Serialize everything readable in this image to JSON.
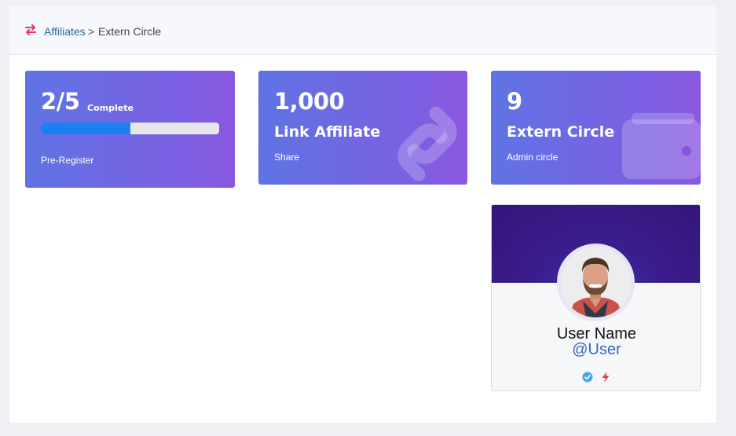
{
  "breadcrumb": {
    "icon": "arrows-swap-icon",
    "link": "Affiliates",
    "separator": ">",
    "current": "Extern Circle"
  },
  "cards": [
    {
      "value": "2/5",
      "value_suffix": "Complete",
      "progress": 0.5,
      "caption": "Pre-Register"
    },
    {
      "value": "1,000",
      "title": "Link Affiliate",
      "caption": "Share",
      "icon": "link-icon"
    },
    {
      "value": "9",
      "title": "Extern Circle",
      "caption": "Admin circle",
      "icon": "wallet-icon"
    }
  ],
  "profile": {
    "name": "User Name",
    "handle": "@User",
    "badges": [
      "verified-check-icon",
      "lightning-icon"
    ]
  },
  "colors": {
    "accent": "#e8336d",
    "link": "#2f5fae",
    "card_gradient_start": "#5f74e3",
    "card_gradient_end": "#8a58e0",
    "progress_fill": "#1d80f2",
    "verified": "#4aa3e8",
    "lightning": "#e8374a"
  }
}
